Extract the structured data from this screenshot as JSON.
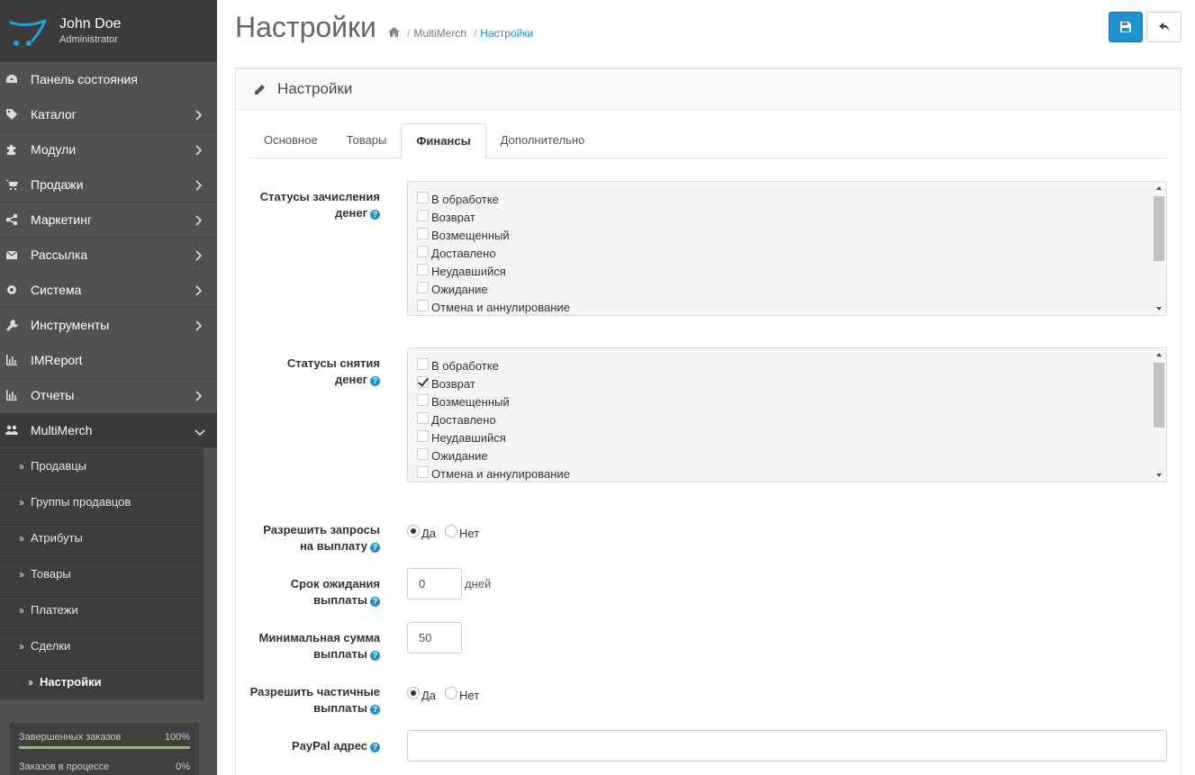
{
  "profile": {
    "name": "John Doe",
    "role": "Administrator"
  },
  "menu": [
    {
      "label": "Панель состояния",
      "icon": "dashboard-icon"
    },
    {
      "label": "Каталог",
      "icon": "tags-icon"
    },
    {
      "label": "Модули",
      "icon": "puzzle-icon"
    },
    {
      "label": "Продажи",
      "icon": "cart-icon"
    },
    {
      "label": "Маркетинг",
      "icon": "share-icon"
    },
    {
      "label": "Рассылка",
      "icon": "envelope-icon"
    },
    {
      "label": "Система",
      "icon": "cog-icon"
    },
    {
      "label": "Инструменты",
      "icon": "wrench-icon"
    },
    {
      "label": "IMReport",
      "icon": "bar-chart-icon"
    },
    {
      "label": "Отчеты",
      "icon": "bar-chart-icon"
    },
    {
      "label": "MultiMerch",
      "icon": "users-icon"
    }
  ],
  "submenu": [
    {
      "label": "Продавцы"
    },
    {
      "label": "Группы продавцов"
    },
    {
      "label": "Атрибуты"
    },
    {
      "label": "Товары"
    },
    {
      "label": "Платежи"
    },
    {
      "label": "Сделки"
    },
    {
      "label": "Настройки"
    }
  ],
  "progress": [
    {
      "label": "Завершенных заказов",
      "value": "100%",
      "fraction": 1.0
    },
    {
      "label": "Заказов в процессе",
      "value": "0%",
      "fraction": 0.0
    }
  ],
  "page": {
    "title": "Настройки",
    "breadcrumb": [
      "MultiMerch",
      "Настройки"
    ]
  },
  "panel": {
    "title": "Настройки",
    "tabs": [
      "Основное",
      "Товары",
      "Финансы",
      "Дополнительно"
    ],
    "active_tab": "Финансы"
  },
  "form": {
    "credit_statuses": {
      "label_line1": "Статусы зачисления",
      "label_line2": "денег",
      "options": [
        {
          "label": "В обработке",
          "checked": false
        },
        {
          "label": "Возврат",
          "checked": false
        },
        {
          "label": "Возмещенный",
          "checked": false
        },
        {
          "label": "Доставлено",
          "checked": false
        },
        {
          "label": "Неудавшийся",
          "checked": false
        },
        {
          "label": "Ожидание",
          "checked": false
        },
        {
          "label": "Отмена и аннулирование",
          "checked": false
        }
      ]
    },
    "debit_statuses": {
      "label_line1": "Статусы снятия",
      "label_line2": "денег",
      "options": [
        {
          "label": "В обработке",
          "checked": false
        },
        {
          "label": "Возврат",
          "checked": true
        },
        {
          "label": "Возмещенный",
          "checked": false
        },
        {
          "label": "Доставлено",
          "checked": false
        },
        {
          "label": "Неудавшийся",
          "checked": false
        },
        {
          "label": "Ожидание",
          "checked": false
        },
        {
          "label": "Отмена и аннулирование",
          "checked": false
        }
      ]
    },
    "allow_payout": {
      "label_line1": "Разрешить запросы",
      "label_line2": "на выплату",
      "yes": "Да",
      "no": "Нет",
      "value": "yes"
    },
    "payout_wait": {
      "label_line1": "Срок ожидания",
      "label_line2": "выплаты",
      "value": "0",
      "suffix": "дней"
    },
    "min_payout": {
      "label_line1": "Минимальная сумма",
      "label_line2": "выплаты",
      "value": "50"
    },
    "partial_payout": {
      "label_line1": "Разрешить частичные",
      "label_line2": "выплаты",
      "yes": "Да",
      "no": "Нет",
      "value": "yes"
    },
    "paypal": {
      "label": "PayPal адрес",
      "value": ""
    }
  },
  "colors": {
    "primary": "#1e91cf",
    "sidebar": "#515151",
    "progress": "#8fbb6c"
  }
}
